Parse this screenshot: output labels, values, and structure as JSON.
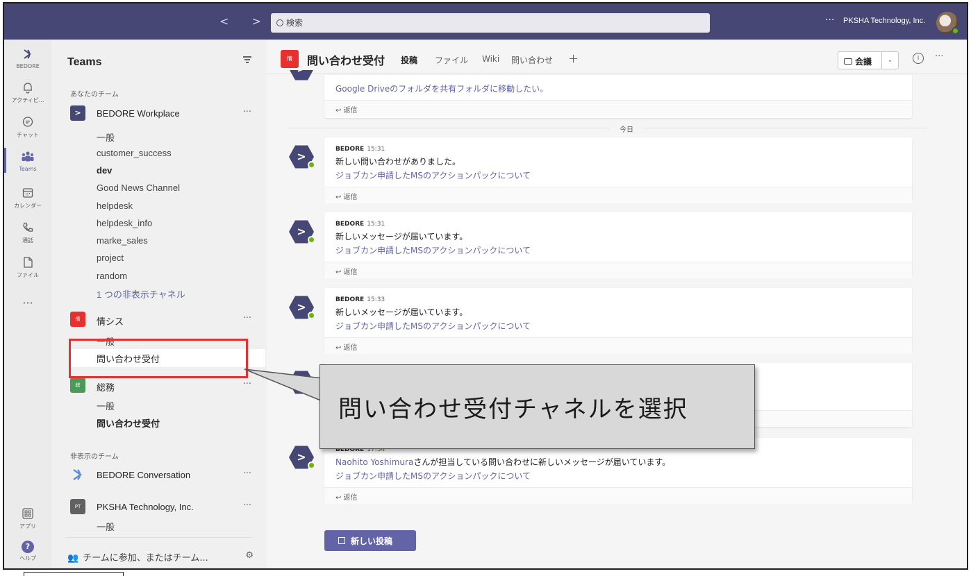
{
  "topbar": {
    "nav_arrows": "<  >",
    "search_placeholder": "検索",
    "more": "···",
    "org_name": "PKSHA Technology, Inc."
  },
  "rail": {
    "items": [
      {
        "label": "BEDORE",
        "icon": "bedore-logo-icon"
      },
      {
        "label": "アクティビ...",
        "icon": "bell-icon"
      },
      {
        "label": "チャット",
        "icon": "chat-icon"
      },
      {
        "label": "Teams",
        "icon": "teams-icon",
        "active": true
      },
      {
        "label": "カレンダー",
        "icon": "calendar-icon"
      },
      {
        "label": "通話",
        "icon": "phone-icon"
      },
      {
        "label": "ファイル",
        "icon": "file-icon"
      }
    ],
    "more": "···",
    "apps_label": "アプリ",
    "help_label": "ヘルプ"
  },
  "panel": {
    "title": "Teams",
    "your_teams_label": "あなたのチーム",
    "hidden_teams_label": "非表示のチーム",
    "teams": [
      {
        "name": "BEDORE Workplace",
        "tile_color": "#464775",
        "tile_text": ">",
        "channels": [
          "一般",
          "customer_success",
          "dev",
          "Good News Channel",
          "helpdesk",
          "helpdesk_info",
          "marke_sales",
          "project",
          "random"
        ],
        "hidden_link": "1 つの非表示チャネル"
      },
      {
        "name": "情シス",
        "tile_color": "#e8312f",
        "tile_text": "情",
        "channels": [
          "一般",
          "問い合わせ受付"
        ]
      },
      {
        "name": "総務",
        "tile_color": "#4a9a57",
        "tile_text": "総",
        "channels": [
          "一般",
          "問い合わせ受付"
        ]
      }
    ],
    "hidden_teams": [
      {
        "name": "BEDORE Conversation"
      },
      {
        "name": "PKSHA Technology, Inc.",
        "tile_text": "PT",
        "channels": [
          "一般"
        ]
      }
    ],
    "join_label": "チームに参加、またはチーム..."
  },
  "channel_header": {
    "tile_text": "情",
    "title": "問い合わせ受付",
    "tabs": [
      "投稿",
      "ファイル",
      "Wiki",
      "問い合わせ"
    ],
    "add_tab": "＋",
    "meet_label": "会議",
    "info": "i",
    "more": "···"
  },
  "feed": {
    "top_partial_line": "Google Driveのフォルダを共有フォルダに移動したい。",
    "reply_label": "返信",
    "today_divider": "今日",
    "posts": [
      {
        "sender": "BEDORE",
        "time": "15:31",
        "line1": "新しい問い合わせがありました。",
        "line2": "ジョブカン申請したMSのアクションパックについて"
      },
      {
        "sender": "BEDORE",
        "time": "15:31",
        "line1": "新しいメッセージが届いています。",
        "line2": "ジョブカン申請したMSのアクションパックについて"
      },
      {
        "sender": "BEDORE",
        "time": "15:33",
        "line1": "新しいメッセージが届いています。",
        "line2": "ジョブカン申請したMSのアクションパックについて"
      },
      {
        "sender": "BEDORE",
        "time": "17:34",
        "line1_link": "Naohito Yoshimura",
        "line1": "さんが担当している問い合わせに新しいメッセージが届いています。",
        "line2": "ジョブカン申請したMSのアクションパックについて"
      }
    ],
    "new_post_label": "新しい投稿"
  },
  "annotation": {
    "callout_text": "問い合わせ受付チャネルを選択",
    "highlight_color": "#e8312f"
  },
  "colors": {
    "topbar": "#464775",
    "accent": "#6264a7",
    "presence": "#6bb700"
  }
}
